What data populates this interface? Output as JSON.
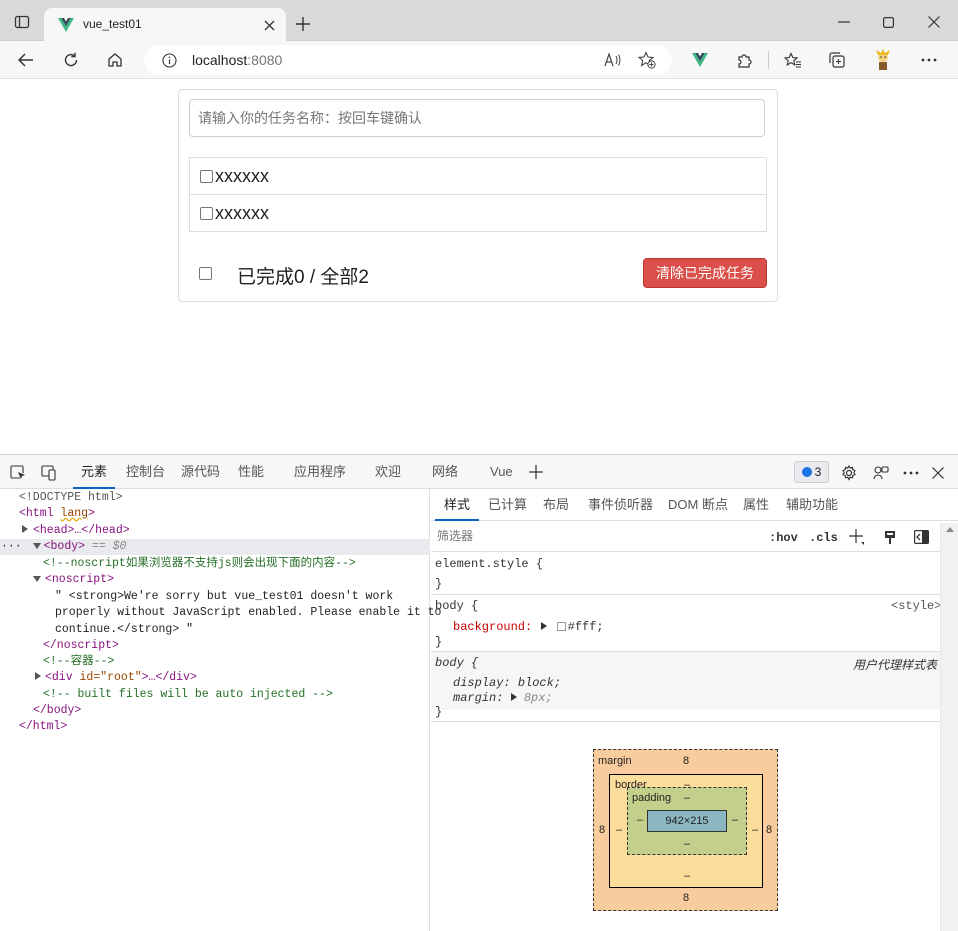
{
  "browser": {
    "tab_title": "vue_test01",
    "url": "localhost:8080",
    "url_host": "localhost",
    "url_port": ":8080"
  },
  "todo": {
    "input_placeholder": "请输入你的任务名称：按回车键确认",
    "items": [
      {
        "title": "xxxxxx",
        "done": false
      },
      {
        "title": "xxxxxx",
        "done": false
      }
    ],
    "footer_done_label": "已完成0 / 全部2",
    "clear_button": "清除已完成任务"
  },
  "devtools": {
    "tabs": [
      "元素",
      "控制台",
      "源代码",
      "性能",
      "应用程序",
      "欢迎",
      "网络",
      "Vue"
    ],
    "issues_count": "3",
    "dom": {
      "doctype": "<!DOCTYPE html>",
      "html_open_tag": "<html",
      "html_lang": "lang",
      "html_gt": ">",
      "head": "<head>…</head>",
      "body_open": "<body>",
      "body_eq": " == $0",
      "comment1": "<!--noscript如果浏览器不支持js则会出现下面的内容-->",
      "noscript_open": "<noscript>",
      "noscript_text1": "\" <strong>We're sorry but vue_test01 doesn't work",
      "noscript_text2": "properly without JavaScript enabled. Please enable it to",
      "noscript_text3": "continue.</strong> \"",
      "noscript_close": "</noscript>",
      "comment2": "<!--容器-->",
      "div_open": "<div ",
      "div_attr": "id=\"root\"",
      "div_rest": ">…</div>",
      "comment3": "<!-- built files will be auto injected -->",
      "body_close": "</body>",
      "html_close": "</html>"
    },
    "style_tabs": [
      "样式",
      "已计算",
      "布局",
      "事件侦听器",
      "DOM 断点",
      "属性",
      "辅助功能"
    ],
    "filter_placeholder": "筛选器",
    "hov": ":hov",
    "cls": ".cls",
    "rules": {
      "element_style": "element.style {",
      "close": "}",
      "body_selector": "body {",
      "body_source": "<style>",
      "bg_prop": "background:",
      "bg_val": "#fff;",
      "ua_selector": "body {",
      "ua_source": "用户代理样式表",
      "display_prop": "display:",
      "display_val": "block;",
      "margin_prop": "margin:",
      "margin_val": "8px;"
    },
    "box_model": {
      "margin_label": "margin",
      "border_label": "border",
      "padding_label": "padding",
      "content": "942×215",
      "margin_top": "8",
      "margin_bottom": "8",
      "margin_left": "8",
      "margin_right": "8",
      "dash": "–"
    }
  }
}
